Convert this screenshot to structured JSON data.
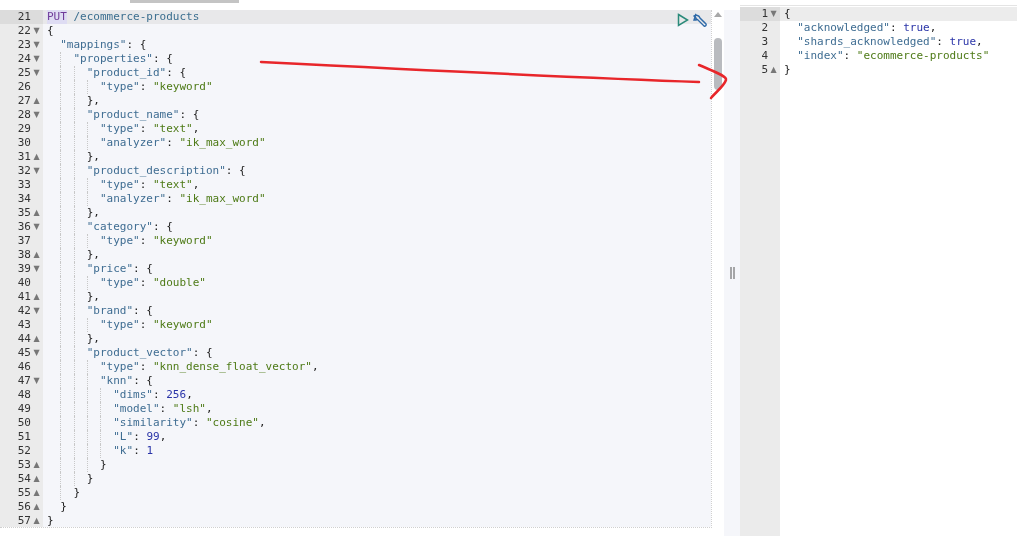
{
  "request_editor": {
    "lines": [
      {
        "no": "21",
        "active": true,
        "kind": "request",
        "method": "PUT",
        "path": "/ecommerce-products"
      },
      {
        "no": "22",
        "active": false,
        "fold": "▼",
        "text": "{"
      },
      {
        "no": "23",
        "active": false,
        "fold": "▼",
        "text": "  \"mappings\": {"
      },
      {
        "no": "24",
        "active": false,
        "fold": "▼",
        "text": "    \"properties\": {"
      },
      {
        "no": "25",
        "active": false,
        "fold": "▼",
        "text": "      \"product_id\": {"
      },
      {
        "no": "26",
        "active": false,
        "text": "        \"type\": \"keyword\""
      },
      {
        "no": "27",
        "active": false,
        "fold": "▲",
        "text": "      },"
      },
      {
        "no": "28",
        "active": false,
        "fold": "▼",
        "text": "      \"product_name\": {"
      },
      {
        "no": "29",
        "active": false,
        "text": "        \"type\": \"text\","
      },
      {
        "no": "30",
        "active": false,
        "text": "        \"analyzer\": \"ik_max_word\""
      },
      {
        "no": "31",
        "active": false,
        "fold": "▲",
        "text": "      },"
      },
      {
        "no": "32",
        "active": false,
        "fold": "▼",
        "text": "      \"product_description\": {"
      },
      {
        "no": "33",
        "active": false,
        "text": "        \"type\": \"text\","
      },
      {
        "no": "34",
        "active": false,
        "text": "        \"analyzer\": \"ik_max_word\""
      },
      {
        "no": "35",
        "active": false,
        "fold": "▲",
        "text": "      },"
      },
      {
        "no": "36",
        "active": false,
        "fold": "▼",
        "text": "      \"category\": {"
      },
      {
        "no": "37",
        "active": false,
        "text": "        \"type\": \"keyword\""
      },
      {
        "no": "38",
        "active": false,
        "fold": "▲",
        "text": "      },"
      },
      {
        "no": "39",
        "active": false,
        "fold": "▼",
        "text": "      \"price\": {"
      },
      {
        "no": "40",
        "active": false,
        "text": "        \"type\": \"double\""
      },
      {
        "no": "41",
        "active": false,
        "fold": "▲",
        "text": "      },"
      },
      {
        "no": "42",
        "active": false,
        "fold": "▼",
        "text": "      \"brand\": {"
      },
      {
        "no": "43",
        "active": false,
        "text": "        \"type\": \"keyword\""
      },
      {
        "no": "44",
        "active": false,
        "fold": "▲",
        "text": "      },"
      },
      {
        "no": "45",
        "active": false,
        "fold": "▼",
        "text": "      \"product_vector\": {"
      },
      {
        "no": "46",
        "active": false,
        "text": "        \"type\": \"knn_dense_float_vector\","
      },
      {
        "no": "47",
        "active": false,
        "fold": "▼",
        "text": "        \"knn\": {"
      },
      {
        "no": "48",
        "active": false,
        "text": "          \"dims\": 256,"
      },
      {
        "no": "49",
        "active": false,
        "text": "          \"model\": \"lsh\","
      },
      {
        "no": "50",
        "active": false,
        "text": "          \"similarity\": \"cosine\","
      },
      {
        "no": "51",
        "active": false,
        "text": "          \"L\": 99,"
      },
      {
        "no": "52",
        "active": false,
        "text": "          \"k\": 1"
      },
      {
        "no": "53",
        "active": false,
        "fold": "▲",
        "text": "        }"
      },
      {
        "no": "54",
        "active": false,
        "fold": "▲",
        "text": "      }"
      },
      {
        "no": "55",
        "active": false,
        "fold": "▲",
        "text": "    }"
      },
      {
        "no": "56",
        "active": false,
        "fold": "▲",
        "text": "  }"
      },
      {
        "no": "57",
        "active": false,
        "fold": "▲",
        "text": "}"
      }
    ]
  },
  "response_editor": {
    "lines": [
      {
        "no": "1",
        "active": true,
        "fold": "▼",
        "text": "{"
      },
      {
        "no": "2",
        "active": false,
        "text": "  \"acknowledged\": true,"
      },
      {
        "no": "3",
        "active": false,
        "text": "  \"shards_acknowledged\": true,"
      },
      {
        "no": "4",
        "active": false,
        "text": "  \"index\": \"ecommerce-products\""
      },
      {
        "no": "5",
        "active": false,
        "fold": "▲",
        "text": "}"
      }
    ]
  }
}
